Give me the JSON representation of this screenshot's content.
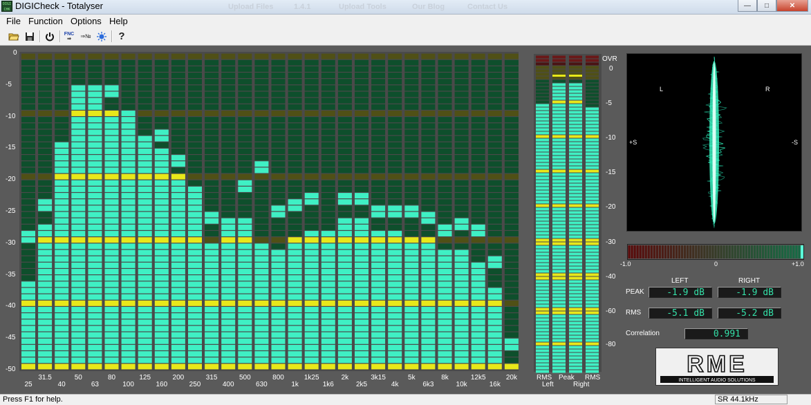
{
  "window": {
    "title": "DIGICheck - Totalyser",
    "icon": "digicheck-app-icon",
    "background_tabs": [
      "Upload Files",
      "1.4.1",
      "Upload Tools",
      "Our Blog",
      "Contact Us"
    ],
    "controls": [
      "minimize",
      "maximize",
      "close"
    ]
  },
  "menu": [
    "File",
    "Function",
    "Options",
    "Help"
  ],
  "toolbar": {
    "buttons": [
      "open-folder-icon",
      "save-icon",
      "power-icon",
      "function-icon",
      "function-b-icon",
      "settings-sun-icon",
      "help-icon"
    ]
  },
  "colors": {
    "background": "#5a5a5a",
    "meter_off": "#0e4f2c",
    "meter_on": "#3ff0c4",
    "meter_yellow": "#e8e81a",
    "meter_olive": "#505016",
    "meter_red_dark": "#4a1414"
  },
  "chart_data": [
    {
      "type": "bar",
      "title": "",
      "categories": [
        "25",
        "31.5",
        "40",
        "50",
        "63",
        "80",
        "100",
        "125",
        "160",
        "200",
        "250",
        "315",
        "400",
        "500",
        "630",
        "800",
        "1k",
        "1k25",
        "1k6",
        "2k",
        "2k5",
        "3k15",
        "4k",
        "5k",
        "6k3",
        "8k",
        "10k",
        "12k5",
        "16k",
        "20k"
      ],
      "series": [
        {
          "name": "level",
          "values": [
            -36,
            -27,
            -14,
            -5,
            -5,
            -9,
            -11,
            -15,
            -15,
            -19,
            -23,
            -30,
            -26,
            -26,
            -30,
            -31,
            -29,
            -28,
            -29,
            -26,
            -26,
            -28,
            -28,
            -29,
            -29,
            -31,
            -31,
            -33,
            -37,
            -49
          ]
        },
        {
          "name": "peak",
          "values": [
            -28,
            -23,
            -14,
            -5,
            -5,
            -5,
            -9,
            -13,
            -12,
            -16,
            -21,
            -25,
            -26,
            -20,
            -17,
            -24,
            -23,
            -22,
            -28,
            -22,
            -22,
            -24,
            -24,
            -24,
            -25,
            -27,
            -26,
            -27,
            -32,
            -45
          ]
        }
      ],
      "ylim": [
        -50,
        0
      ],
      "yticks": [
        "0",
        "-5",
        "-10",
        "-15",
        "-20",
        "-25",
        "-30",
        "-35",
        "-40",
        "-45",
        "-50"
      ],
      "highlight_rows_db": [
        -10,
        -20,
        -30,
        -40,
        -50
      ]
    },
    {
      "type": "bar",
      "title": "",
      "categories": [
        "RMS Left",
        "Peak Left",
        "Peak Right",
        "RMS Right"
      ],
      "values": [
        -5.1,
        -1.9,
        -1.9,
        -5.2
      ],
      "scale_labels": [
        "OVR",
        "0",
        "-5",
        "-10",
        "-15",
        "-20",
        "-30",
        "-40",
        "-60",
        "-80"
      ],
      "bottom_labels": {
        "left": [
          "RMS",
          "Left"
        ],
        "peak": "Peak",
        "right": [
          "RMS",
          "Right"
        ]
      }
    },
    {
      "type": "bar",
      "title": "",
      "categories": [
        "correlation"
      ],
      "values": [
        0.991
      ],
      "xlim": [
        -1.0,
        1.0
      ],
      "scale_labels": [
        "-1.0",
        "0",
        "+1.0"
      ]
    }
  ],
  "goniometer": {
    "labels": {
      "left": "L",
      "right": "R",
      "plus_s": "+S",
      "minus_s": "-S"
    }
  },
  "readouts": {
    "header_left": "LEFT",
    "header_right": "RIGHT",
    "peak_label": "PEAK",
    "rms_label": "RMS",
    "peak_left": "-1.9 dB",
    "peak_right": "-1.9 dB",
    "rms_left": "-5.1 dB",
    "rms_right": "-5.2 dB",
    "correlation_label": "Correlation",
    "correlation_value": "0.991"
  },
  "logo": {
    "brand": "RME",
    "tagline": "INTELLIGENT AUDIO SOLUTIONS"
  },
  "status": {
    "text": "Press F1 for help.",
    "sample_rate": "SR 44.1kHz"
  }
}
